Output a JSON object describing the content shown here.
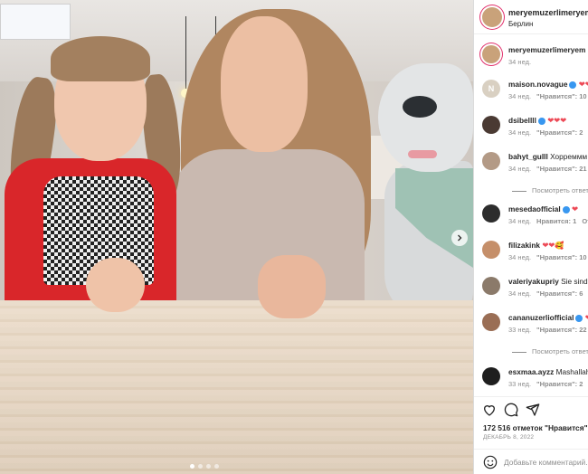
{
  "post": {
    "author": "meryemuzerlimeryem",
    "location": "Берлин",
    "author_time": "34 нед."
  },
  "comments": [
    {
      "user": "maison.novague",
      "text": "❤❤",
      "time": "34 нед.",
      "likes": "\"Нравится\": 10",
      "avatar_color": "#d9d0c2",
      "avatar_text": "N",
      "verified": true
    },
    {
      "user": "dsibellll",
      "text": "❤❤❤",
      "time": "34 нед.",
      "likes": "\"Нравится\": 2",
      "avatar_color": "#4a3a33",
      "avatar_text": "",
      "verified": true
    },
    {
      "user": "bahyt_gulll",
      "text": "Хорреммм",
      "time": "34 нед.",
      "likes": "\"Нравится\": 21",
      "avatar_color": "#b39a86",
      "avatar_text": "",
      "verified": false
    },
    {
      "user": "mesedaofficial",
      "text": "❤",
      "time": "34 нед.",
      "likes": "Нравится: 1",
      "avatar_color": "#2d2d2d",
      "avatar_text": "",
      "verified": true
    },
    {
      "user": "filizakink",
      "text": "❤❤🥰",
      "time": "34 нед.",
      "likes": "\"Нравится\": 10",
      "avatar_color": "#c58f6a",
      "avatar_text": "",
      "verified": false
    },
    {
      "user": "valeriyakupriy",
      "text": "Sie sind v",
      "time": "34 нед.",
      "likes": "\"Нравится\": 6",
      "avatar_color": "#8b7a6a",
      "avatar_text": "",
      "verified": false
    },
    {
      "user": "cananuzerliofficial",
      "text": "❤",
      "time": "33 нед.",
      "likes": "\"Нравится\": 22",
      "avatar_color": "#9a6e55",
      "avatar_text": "",
      "verified": true
    },
    {
      "user": "esxmaa.ayzz",
      "text": "Mashallah",
      "time": "33 нед.",
      "likes": "\"Нравится\": 2",
      "avatar_color": "#1e1e1e",
      "avatar_text": "",
      "verified": false
    }
  ],
  "reply_label": "Ответ",
  "view_replies": "Посмотреть ответ",
  "likes_total": "172 516 отметок \"Нравится\"",
  "date": "ДЕКАБРЬ 8, 2022",
  "add_comment_placeholder": "Добавьте комментарий...",
  "colors": {
    "accent": "#3897f0",
    "heart": "#ed4956",
    "muted": "#8e8e8e"
  }
}
